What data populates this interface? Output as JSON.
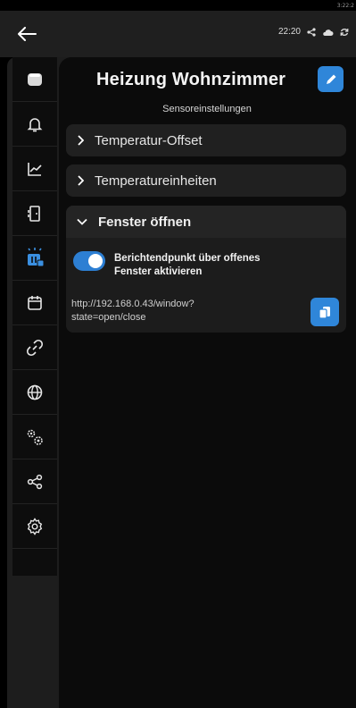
{
  "statusbar": {
    "corner_time": "3:22:2",
    "time": "22:20"
  },
  "header": {
    "title": "Heizung Wohnzimmer",
    "subtitle": "Sensoreinstellungen"
  },
  "sections": [
    {
      "label": "Temperatur-Offset",
      "expanded": false
    },
    {
      "label": "Temperatureinheiten",
      "expanded": false
    }
  ],
  "window_panel": {
    "label": "Fenster öffnen",
    "expanded": true,
    "toggle_label_line1": "Berichtendpunkt über offenes",
    "toggle_label_line2": "Fenster aktivieren",
    "toggle_on": true,
    "url_line1": "http://192.168.0.43/window?",
    "url_line2": "state=open/close"
  },
  "sidebar": {
    "items": [
      {
        "icon": "device-icon",
        "active": false
      },
      {
        "icon": "bell-icon",
        "active": false
      },
      {
        "icon": "chart-icon",
        "active": false
      },
      {
        "icon": "door-icon",
        "active": false
      },
      {
        "icon": "window-sensor-icon",
        "active": true
      },
      {
        "icon": "calendar-icon",
        "active": false
      },
      {
        "icon": "link-icon",
        "active": false
      },
      {
        "icon": "globe-icon",
        "active": false
      },
      {
        "icon": "gears-icon",
        "active": false
      },
      {
        "icon": "share-icon",
        "active": false
      },
      {
        "icon": "settings-icon",
        "active": false
      }
    ]
  },
  "colors": {
    "accent": "#2f86d9",
    "background": "#0b0b0b",
    "panel": "#202020"
  }
}
